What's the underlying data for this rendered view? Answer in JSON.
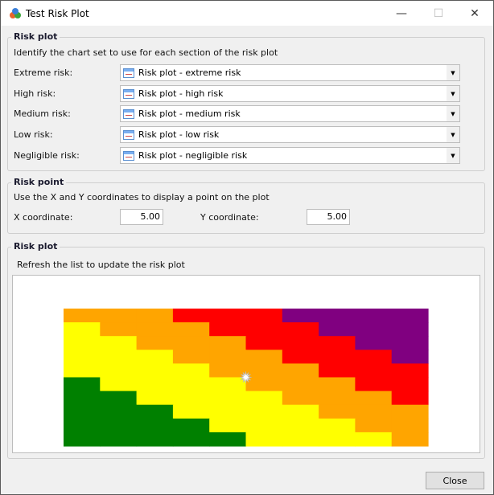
{
  "window": {
    "title": "Test Risk Plot",
    "minimize": "—",
    "maximize": "☐",
    "close": "✕"
  },
  "section1": {
    "legend": "Risk plot",
    "description": "Identify the chart set to use for each section of the risk plot",
    "rows": [
      {
        "label": "Extreme risk:",
        "value": "Risk plot - extreme risk"
      },
      {
        "label": "High risk:",
        "value": "Risk plot - high risk"
      },
      {
        "label": "Medium risk:",
        "value": "Risk plot - medium risk"
      },
      {
        "label": "Low risk:",
        "value": "Risk plot - low risk"
      },
      {
        "label": "Negligible risk:",
        "value": "Risk plot - negligible risk"
      }
    ]
  },
  "section2": {
    "legend": "Risk point",
    "description": "Use the X and Y coordinates to display a point on the plot",
    "x_label": "X coordinate:",
    "x_value": "5.00",
    "y_label": "Y coordinate:",
    "y_value": "5.00"
  },
  "section3": {
    "legend": "Risk plot",
    "description": "Refresh the list to update the risk plot"
  },
  "close_button": "Close",
  "chart_data": {
    "type": "heatmap",
    "xlim": [
      0,
      10
    ],
    "ylim": [
      0,
      10
    ],
    "colors": {
      "G": "#008000",
      "Y": "#ffff00",
      "O": "#ffa500",
      "R": "#ff0000",
      "P": "#800080"
    },
    "rows_top_to_bottom": [
      "OOORRRPPPP",
      "YOOORRRPPP",
      "YYOOORRRPP",
      "YYYOOORRRP",
      "YYYYOOORRR",
      "GYYYYOOORR",
      "GGYYYYOOOR",
      "GGGYYYYOOO",
      "GGGGYYYYOO",
      "GGGGGYYYYO"
    ],
    "point": {
      "x": 5,
      "y": 5
    }
  }
}
